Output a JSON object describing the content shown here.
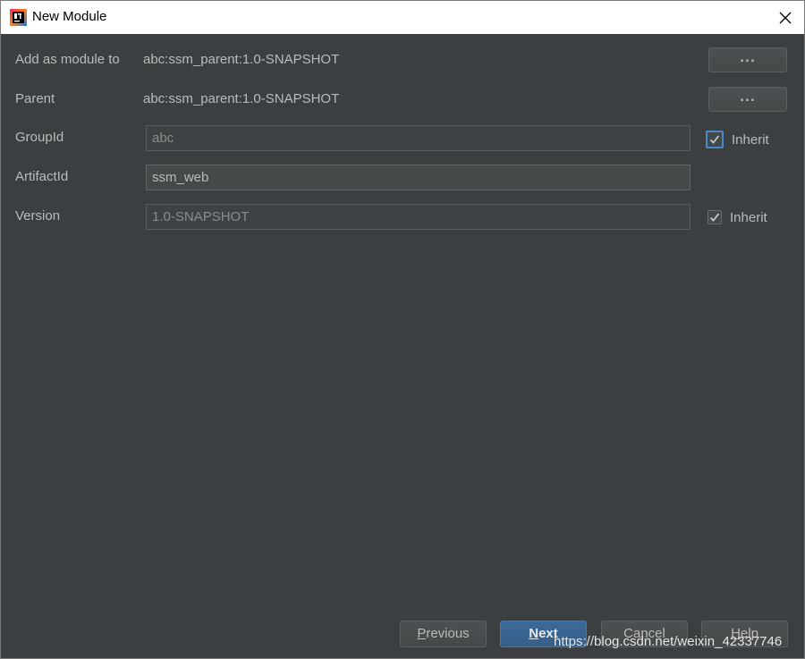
{
  "window": {
    "title": "New Module",
    "app_icon": "intellij-idea-icon",
    "close_icon": "close-icon"
  },
  "form": {
    "add_as_module_to": {
      "label": "Add as module to",
      "value": "abc:ssm_parent:1.0-SNAPSHOT",
      "browse_label": "..."
    },
    "parent": {
      "label": "Parent",
      "value": "abc:ssm_parent:1.0-SNAPSHOT",
      "browse_label": "..."
    },
    "group_id": {
      "label": "GroupId",
      "value": "abc",
      "inherit_label": "Inherit",
      "inherit_checked": true
    },
    "artifact_id": {
      "label": "ArtifactId",
      "value": "ssm_web"
    },
    "version": {
      "label": "Version",
      "value": "1.0-SNAPSHOT",
      "inherit_label": "Inherit",
      "inherit_checked": true
    }
  },
  "footer": {
    "previous": {
      "mnemonic": "P",
      "rest": "revious"
    },
    "next": {
      "mnemonic": "N",
      "rest": "ext"
    },
    "cancel": {
      "label": "Cancel"
    },
    "help": {
      "mnemonic": "H",
      "rest": "elp"
    }
  },
  "watermark": "https://blog.csdn.net/weixin_42337746",
  "colors": {
    "background": "#3c3f41",
    "text": "#bbbbbb",
    "primary_button": "#365e87",
    "focus": "#4a88c7"
  }
}
